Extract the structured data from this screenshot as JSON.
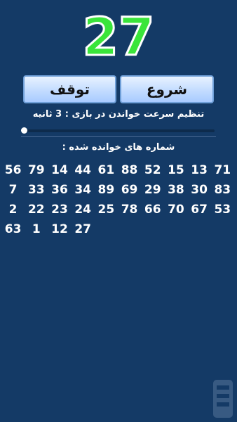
{
  "current_number": "27",
  "buttons": {
    "stop": "توقف",
    "start": "شروع"
  },
  "speed": {
    "label": "تنظیم سرعت خواندن در بازی : 3 ثانیه",
    "slider_value": 0
  },
  "called_label": "شماره های خوانده شده :",
  "called_rows": [
    [
      "56",
      "79",
      "14",
      "44",
      "61",
      "88",
      "52",
      "15",
      "13",
      "71"
    ],
    [
      "7",
      "33",
      "36",
      "34",
      "89",
      "69",
      "29",
      "38",
      "30",
      "83"
    ],
    [
      "2",
      "22",
      "23",
      "24",
      "25",
      "78",
      "66",
      "70",
      "67",
      "53"
    ],
    [
      "63",
      "1",
      "12",
      "27"
    ]
  ],
  "colors": {
    "background": "#143a66",
    "number_fill": "#3ae53a"
  }
}
